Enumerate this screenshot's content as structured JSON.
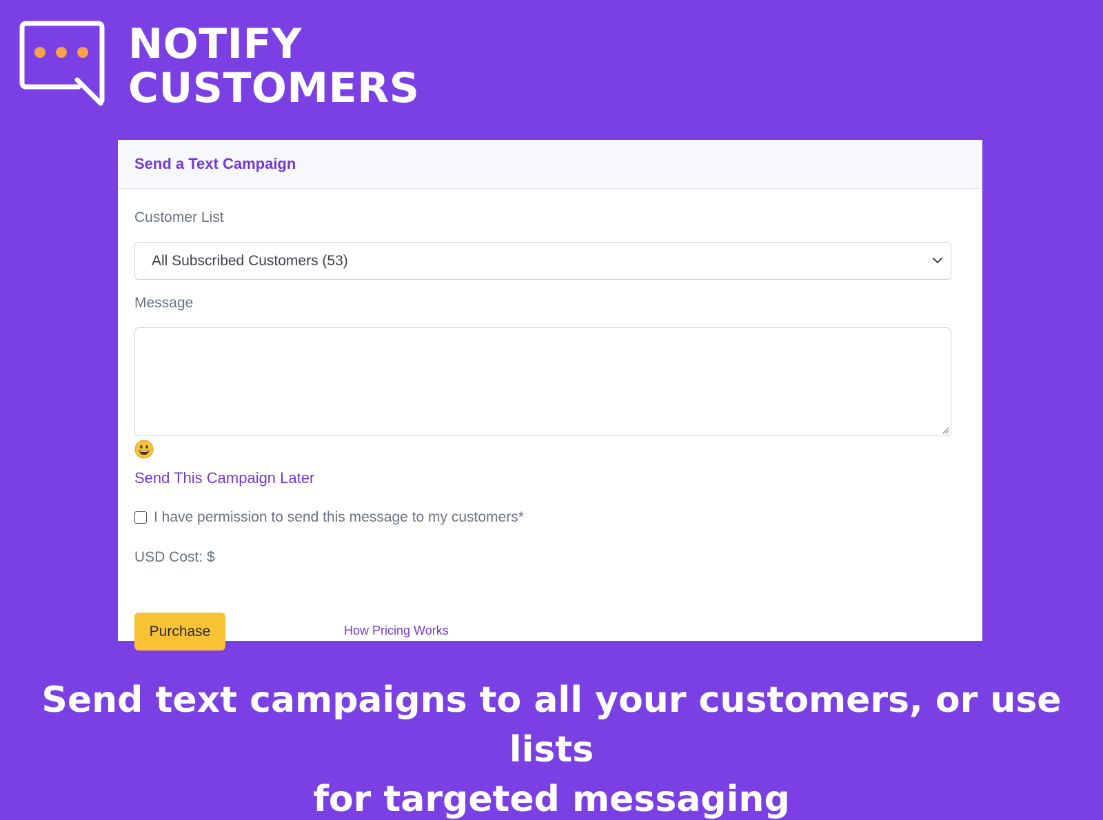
{
  "brand": {
    "line1": "NOTIFY",
    "line2": "CUSTOMERS",
    "logo_icon": "chat-bubble-with-dots-icon",
    "dot_color": "#f7a14a"
  },
  "card": {
    "title": "Send a Text Campaign",
    "customer_list": {
      "label": "Customer List",
      "selected": "All Subscribed Customers (53)"
    },
    "message": {
      "label": "Message",
      "value": "",
      "placeholder": ""
    },
    "emoji_icon": "grinning-face-emoji-icon",
    "schedule_link": "Send This Campaign Later",
    "permission_label": "I have permission to send this message to my customers*",
    "permission_checked": false,
    "cost_label": "USD Cost: $",
    "purchase_label": "Purchase",
    "pricing_link": "How Pricing Works"
  },
  "caption": {
    "line1": "Send text campaigns to all your customers, or use lists",
    "line2": "for targeted messaging"
  },
  "colors": {
    "background": "#7a40e4",
    "accent": "#7239d6",
    "button": "#f8c235"
  }
}
